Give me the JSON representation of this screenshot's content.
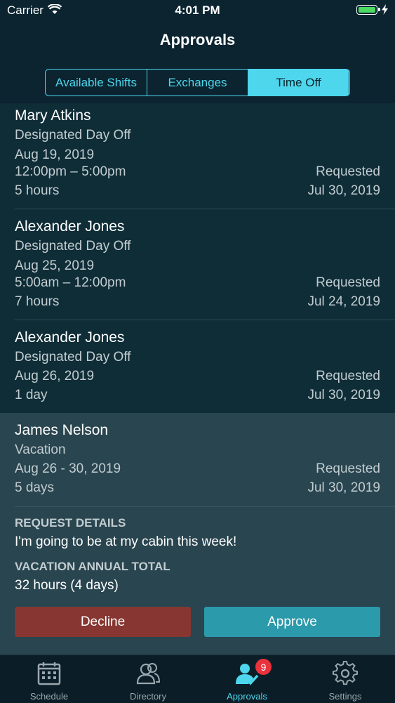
{
  "status": {
    "carrier": "Carrier",
    "time": "4:01 PM"
  },
  "nav": {
    "title": "Approvals"
  },
  "segments": [
    "Available Shifts",
    "Exchanges",
    "Time Off"
  ],
  "requests": [
    {
      "name": "Mary Atkins",
      "type": "Designated Day Off",
      "date": "Aug 19, 2019",
      "time": "12:00pm – 5:00pm",
      "duration": "5 hours",
      "status_label": "Requested",
      "status_date": "Jul 30, 2019"
    },
    {
      "name": "Alexander Jones",
      "type": "Designated Day Off",
      "date": "Aug 25, 2019",
      "time": "5:00am – 12:00pm",
      "duration": "7 hours",
      "status_label": "Requested",
      "status_date": "Jul 24, 2019"
    },
    {
      "name": "Alexander Jones",
      "type": "Designated Day Off",
      "date": "Aug 26, 2019",
      "duration": "1 day",
      "status_label": "Requested",
      "status_date": "Jul 30, 2019"
    },
    {
      "name": "James Nelson",
      "type": "Vacation",
      "date": "Aug 26 - 30, 2019",
      "duration": "5 days",
      "status_label": "Requested",
      "status_date": "Jul 30, 2019"
    }
  ],
  "details": {
    "request_label": "REQUEST DETAILS",
    "request_text": "I'm going to be at my cabin this week!",
    "total_label": "VACATION ANNUAL TOTAL",
    "total_text": "32 hours (4 days)",
    "decline": "Decline",
    "approve": "Approve"
  },
  "tabs": [
    {
      "label": "Schedule",
      "icon": "calendar-icon"
    },
    {
      "label": "Directory",
      "icon": "people-icon"
    },
    {
      "label": "Approvals",
      "icon": "approvals-icon",
      "badge": "9"
    },
    {
      "label": "Settings",
      "icon": "gear-icon"
    }
  ],
  "colors": {
    "accent": "#4dd6ec",
    "decline": "#873631",
    "approve": "#2b9aaa",
    "badge": "#e8323c"
  }
}
